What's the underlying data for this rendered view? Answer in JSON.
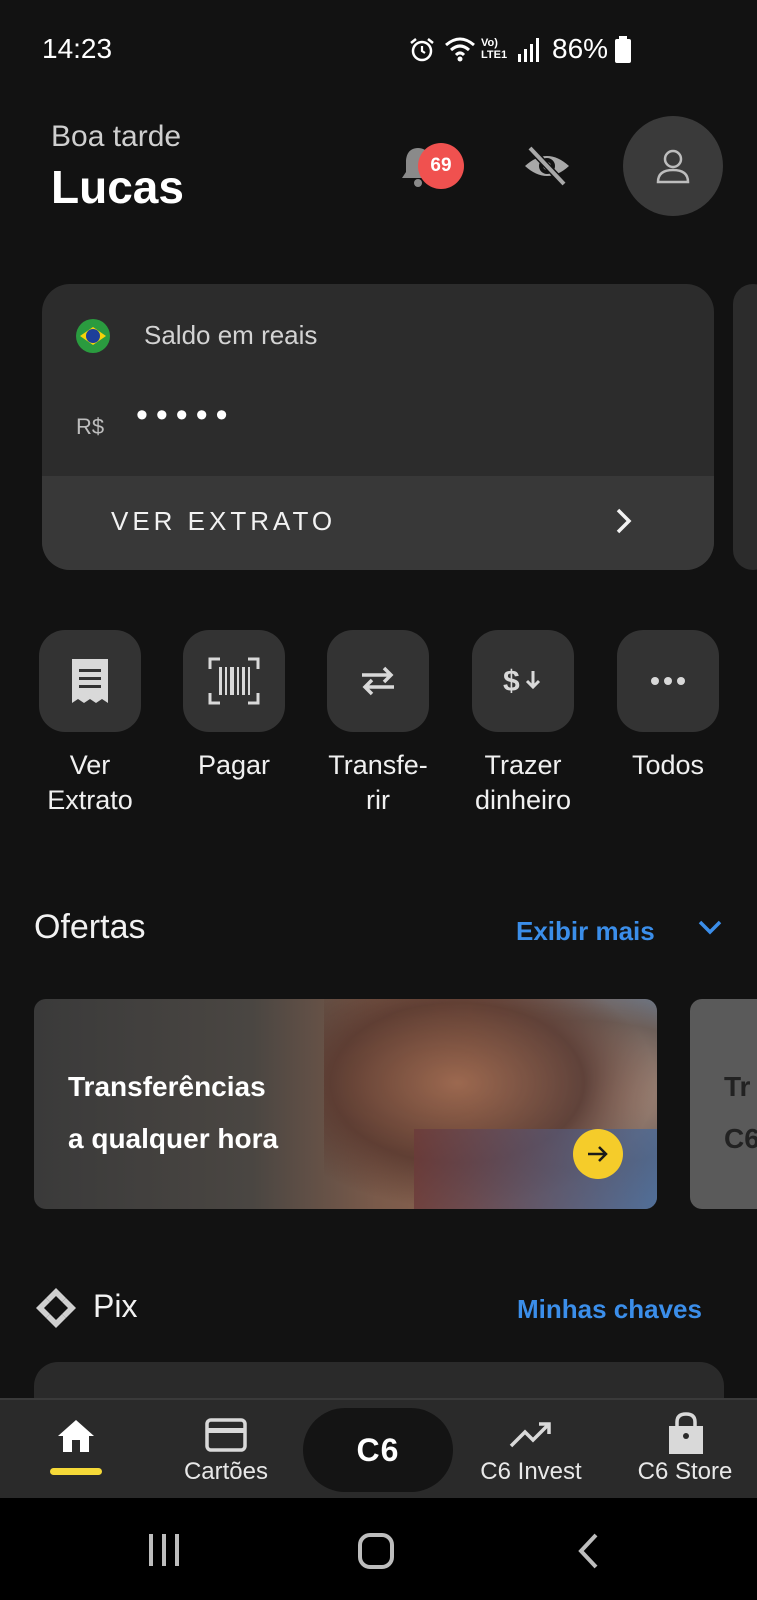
{
  "status_bar": {
    "time": "14:23",
    "battery": "86%",
    "network": "Vo) LTE1"
  },
  "header": {
    "greeting": "Boa tarde",
    "name": "Lucas",
    "notifications_count": "69"
  },
  "balance": {
    "label": "Saldo em reais",
    "currency": "R$",
    "masked_value": "•••••",
    "statement_cta": "VER EXTRATO"
  },
  "quick_actions": [
    {
      "label": "Ver\nExtrato",
      "icon": "receipt-icon"
    },
    {
      "label": "Pagar",
      "icon": "barcode-icon"
    },
    {
      "label": "Transfe-\nrir",
      "icon": "transfer-arrows-icon"
    },
    {
      "label": "Trazer\ndinheiro",
      "icon": "dollar-in-icon"
    },
    {
      "label": "Todos",
      "icon": "more-dots-icon"
    }
  ],
  "offers": {
    "title": "Ofertas",
    "show_more": "Exibir mais",
    "card_text_line1": "Transferências",
    "card_text_line2": "a qualquer hora",
    "peek_line1": "Tr",
    "peek_line2": "C6"
  },
  "pix": {
    "title": "Pix",
    "keys_link": "Minhas chaves"
  },
  "bottom_nav": {
    "home": "",
    "cards": "Cartões",
    "center": "C6",
    "invest": "C6 Invest",
    "store": "C6 Store"
  },
  "colors": {
    "accent_blue": "#3b8eea",
    "badge_red": "#f0514f",
    "yellow": "#f5d938"
  }
}
